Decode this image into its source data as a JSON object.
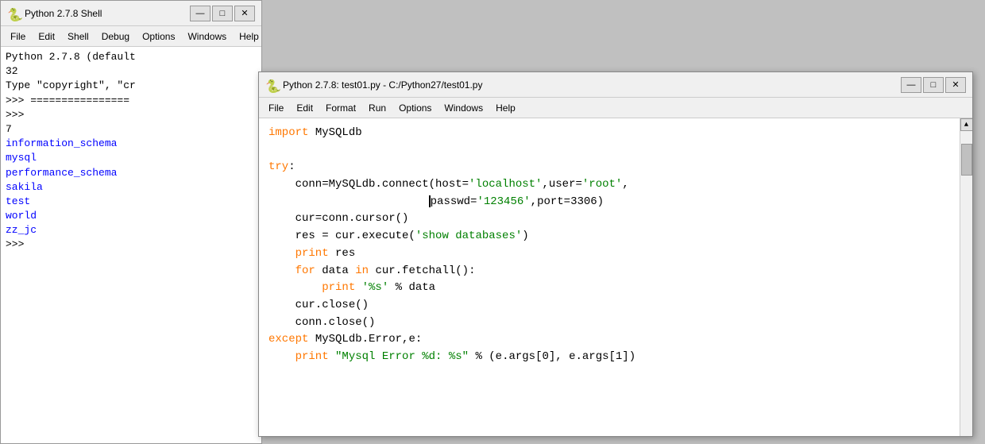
{
  "shell_window": {
    "title": "Python 2.7.8 Shell",
    "icon": "🐍",
    "menu": [
      "File",
      "Edit",
      "Shell",
      "Debug",
      "Options",
      "Windows",
      "Help"
    ],
    "content_lines": [
      "Python 2.7.8 (default",
      "32",
      "Type \"copyright\", \"cr",
      ">>> ================",
      ">>>",
      "7",
      "information_schema",
      "mysql",
      "performance_schema",
      "sakila",
      "test",
      "world",
      "zz_jc",
      ">>>"
    ]
  },
  "editor_window": {
    "title": "Python 2.7.8: test01.py - C:/Python27/test01.py",
    "icon": "🐍",
    "menu": [
      "File",
      "Edit",
      "Format",
      "Run",
      "Options",
      "Windows",
      "Help"
    ],
    "code": [
      {
        "indent": 0,
        "tokens": [
          {
            "type": "kw-orange",
            "text": "import"
          },
          {
            "type": "normal",
            "text": " MySQLdb"
          }
        ]
      },
      {
        "indent": 0,
        "tokens": [
          {
            "type": "normal",
            "text": ""
          }
        ]
      },
      {
        "indent": 0,
        "tokens": [
          {
            "type": "kw-orange",
            "text": "try"
          },
          {
            "type": "normal",
            "text": ":"
          }
        ]
      },
      {
        "indent": 1,
        "tokens": [
          {
            "type": "normal",
            "text": "    conn=MySQLdb.connect(host="
          },
          {
            "type": "str-green",
            "text": "'localhost'"
          },
          {
            "type": "normal",
            "text": ",user="
          },
          {
            "type": "str-green",
            "text": "'root'"
          },
          {
            "type": "normal",
            "text": ","
          }
        ]
      },
      {
        "indent": 2,
        "tokens": [
          {
            "type": "normal",
            "text": "                        passwd="
          },
          {
            "type": "str-green",
            "text": "'123456'"
          },
          {
            "type": "normal",
            "text": ",port=3306)"
          }
        ]
      },
      {
        "indent": 1,
        "tokens": [
          {
            "type": "normal",
            "text": "    cur=conn.cursor()"
          }
        ]
      },
      {
        "indent": 1,
        "tokens": [
          {
            "type": "normal",
            "text": "    res = cur.execute("
          },
          {
            "type": "str-green",
            "text": "'show databases'"
          },
          {
            "type": "normal",
            "text": ")"
          }
        ]
      },
      {
        "indent": 1,
        "tokens": [
          {
            "type": "kw-orange",
            "text": "    print"
          },
          {
            "type": "normal",
            "text": " res"
          }
        ]
      },
      {
        "indent": 1,
        "tokens": [
          {
            "type": "kw-orange",
            "text": "    for"
          },
          {
            "type": "normal",
            "text": " data "
          },
          {
            "type": "kw-orange",
            "text": "in"
          },
          {
            "type": "normal",
            "text": " cur.fetchall():"
          }
        ]
      },
      {
        "indent": 2,
        "tokens": [
          {
            "type": "kw-orange",
            "text": "        print"
          },
          {
            "type": "normal",
            "text": " "
          },
          {
            "type": "str-green",
            "text": "'%s'"
          },
          {
            "type": "normal",
            "text": " % data"
          }
        ]
      },
      {
        "indent": 1,
        "tokens": [
          {
            "type": "normal",
            "text": "    cur.close()"
          }
        ]
      },
      {
        "indent": 1,
        "tokens": [
          {
            "type": "normal",
            "text": "    conn.close()"
          }
        ]
      },
      {
        "indent": 0,
        "tokens": [
          {
            "type": "kw-orange",
            "text": "except"
          },
          {
            "type": "normal",
            "text": " MySQLdb.Error,e:"
          }
        ]
      },
      {
        "indent": 1,
        "tokens": [
          {
            "type": "kw-orange",
            "text": "    print"
          },
          {
            "type": "normal",
            "text": " "
          },
          {
            "type": "str-green",
            "text": "\"Mysql Error %d: %s\""
          },
          {
            "type": "normal",
            "text": " % (e.args[0], e.args[1])"
          }
        ]
      }
    ]
  },
  "controls": {
    "minimize": "—",
    "restore": "□",
    "close": "✕"
  }
}
